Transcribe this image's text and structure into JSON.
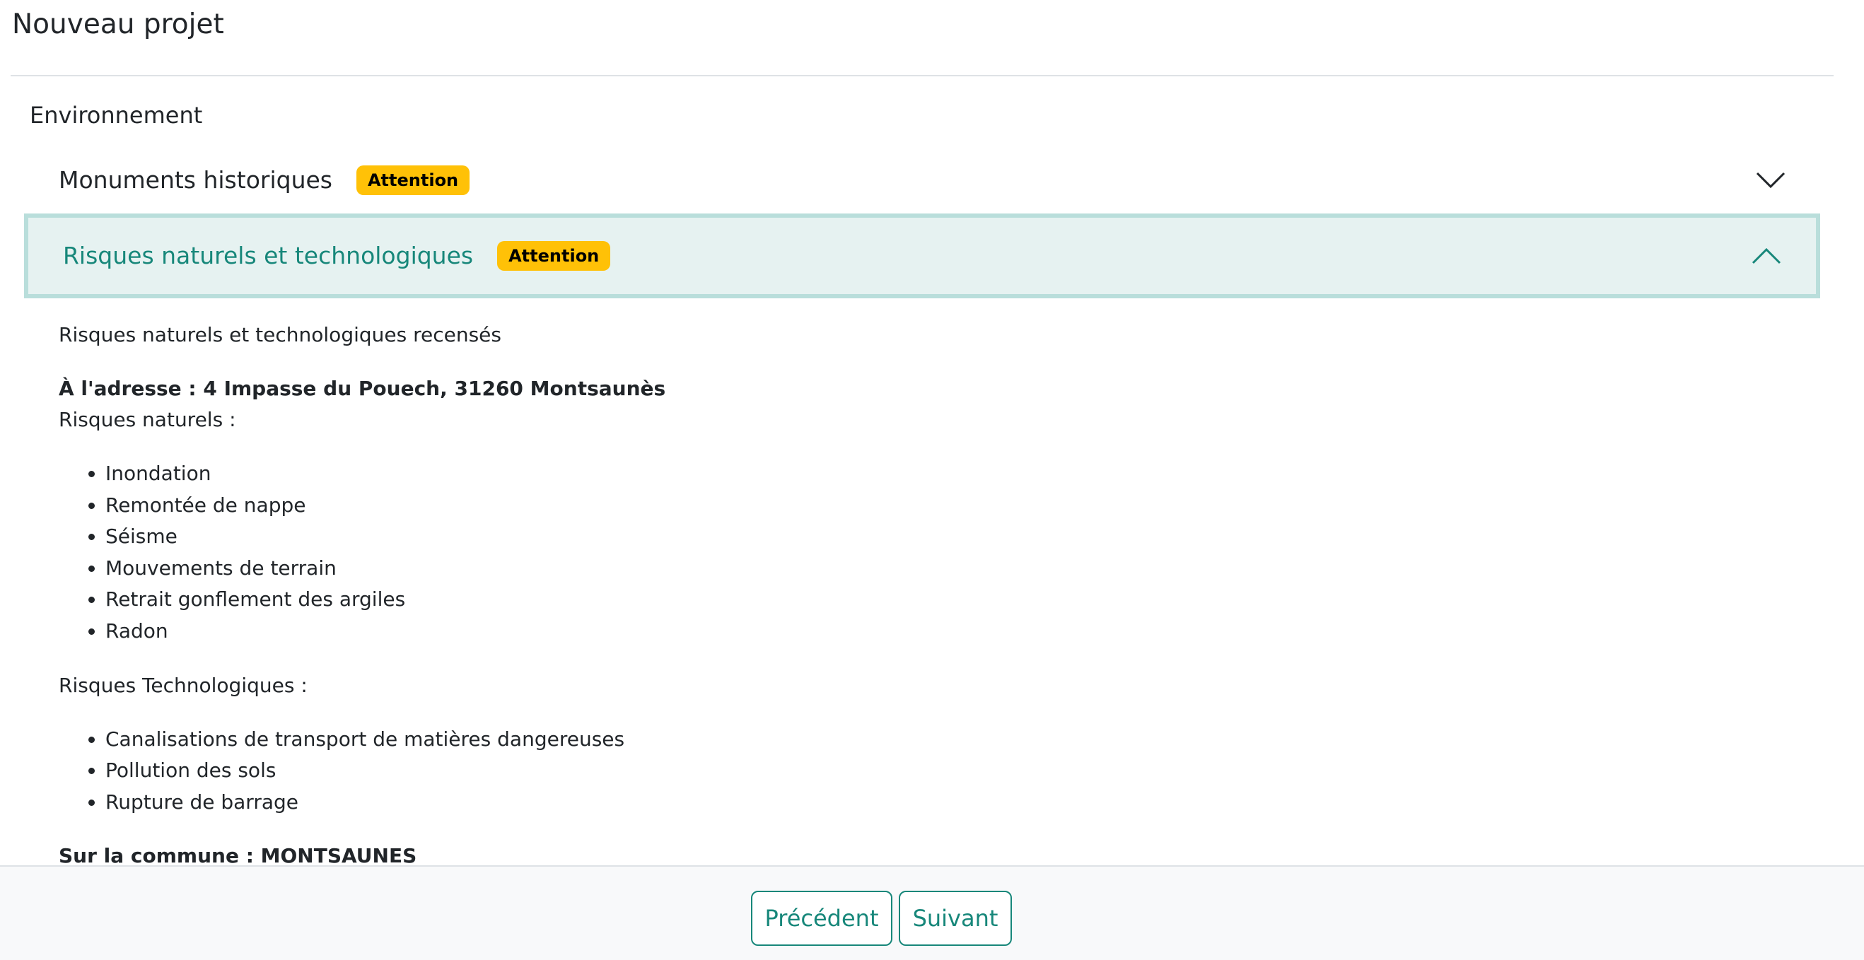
{
  "page": {
    "title": "Nouveau projet",
    "section_label": "Environnement"
  },
  "accordions": [
    {
      "title": "Monuments historiques",
      "badge": "Attention",
      "state": "collapsed",
      "icon": "chevron-down-icon"
    },
    {
      "title": "Risques naturels et technologiques",
      "badge": "Attention",
      "state": "expanded",
      "icon": "chevron-up-icon"
    }
  ],
  "risques": {
    "intro": "Risques naturels et technologiques recensés",
    "address_line": "À l'adresse : 4 Impasse du Pouech, 31260 Montsaunès",
    "naturels_label": "Risques naturels :",
    "naturels": [
      "Inondation",
      "Remontée de nappe",
      "Séisme",
      "Mouvements de terrain",
      "Retrait gonflement des argiles",
      "Radon"
    ],
    "technologiques_label": "Risques Technologiques :",
    "technologiques": [
      "Canalisations de transport de matières dangereuses",
      "Pollution des sols",
      "Rupture de barrage"
    ],
    "commune_line": "Sur la commune : MONTSAUNES"
  },
  "footer": {
    "prev_label": "Précédent",
    "next_label": "Suivant"
  },
  "colors": {
    "accent": "#17877a",
    "badge": "#ffc107",
    "expanded_bg": "#e6f2f1",
    "expanded_border": "#b9dedb"
  }
}
